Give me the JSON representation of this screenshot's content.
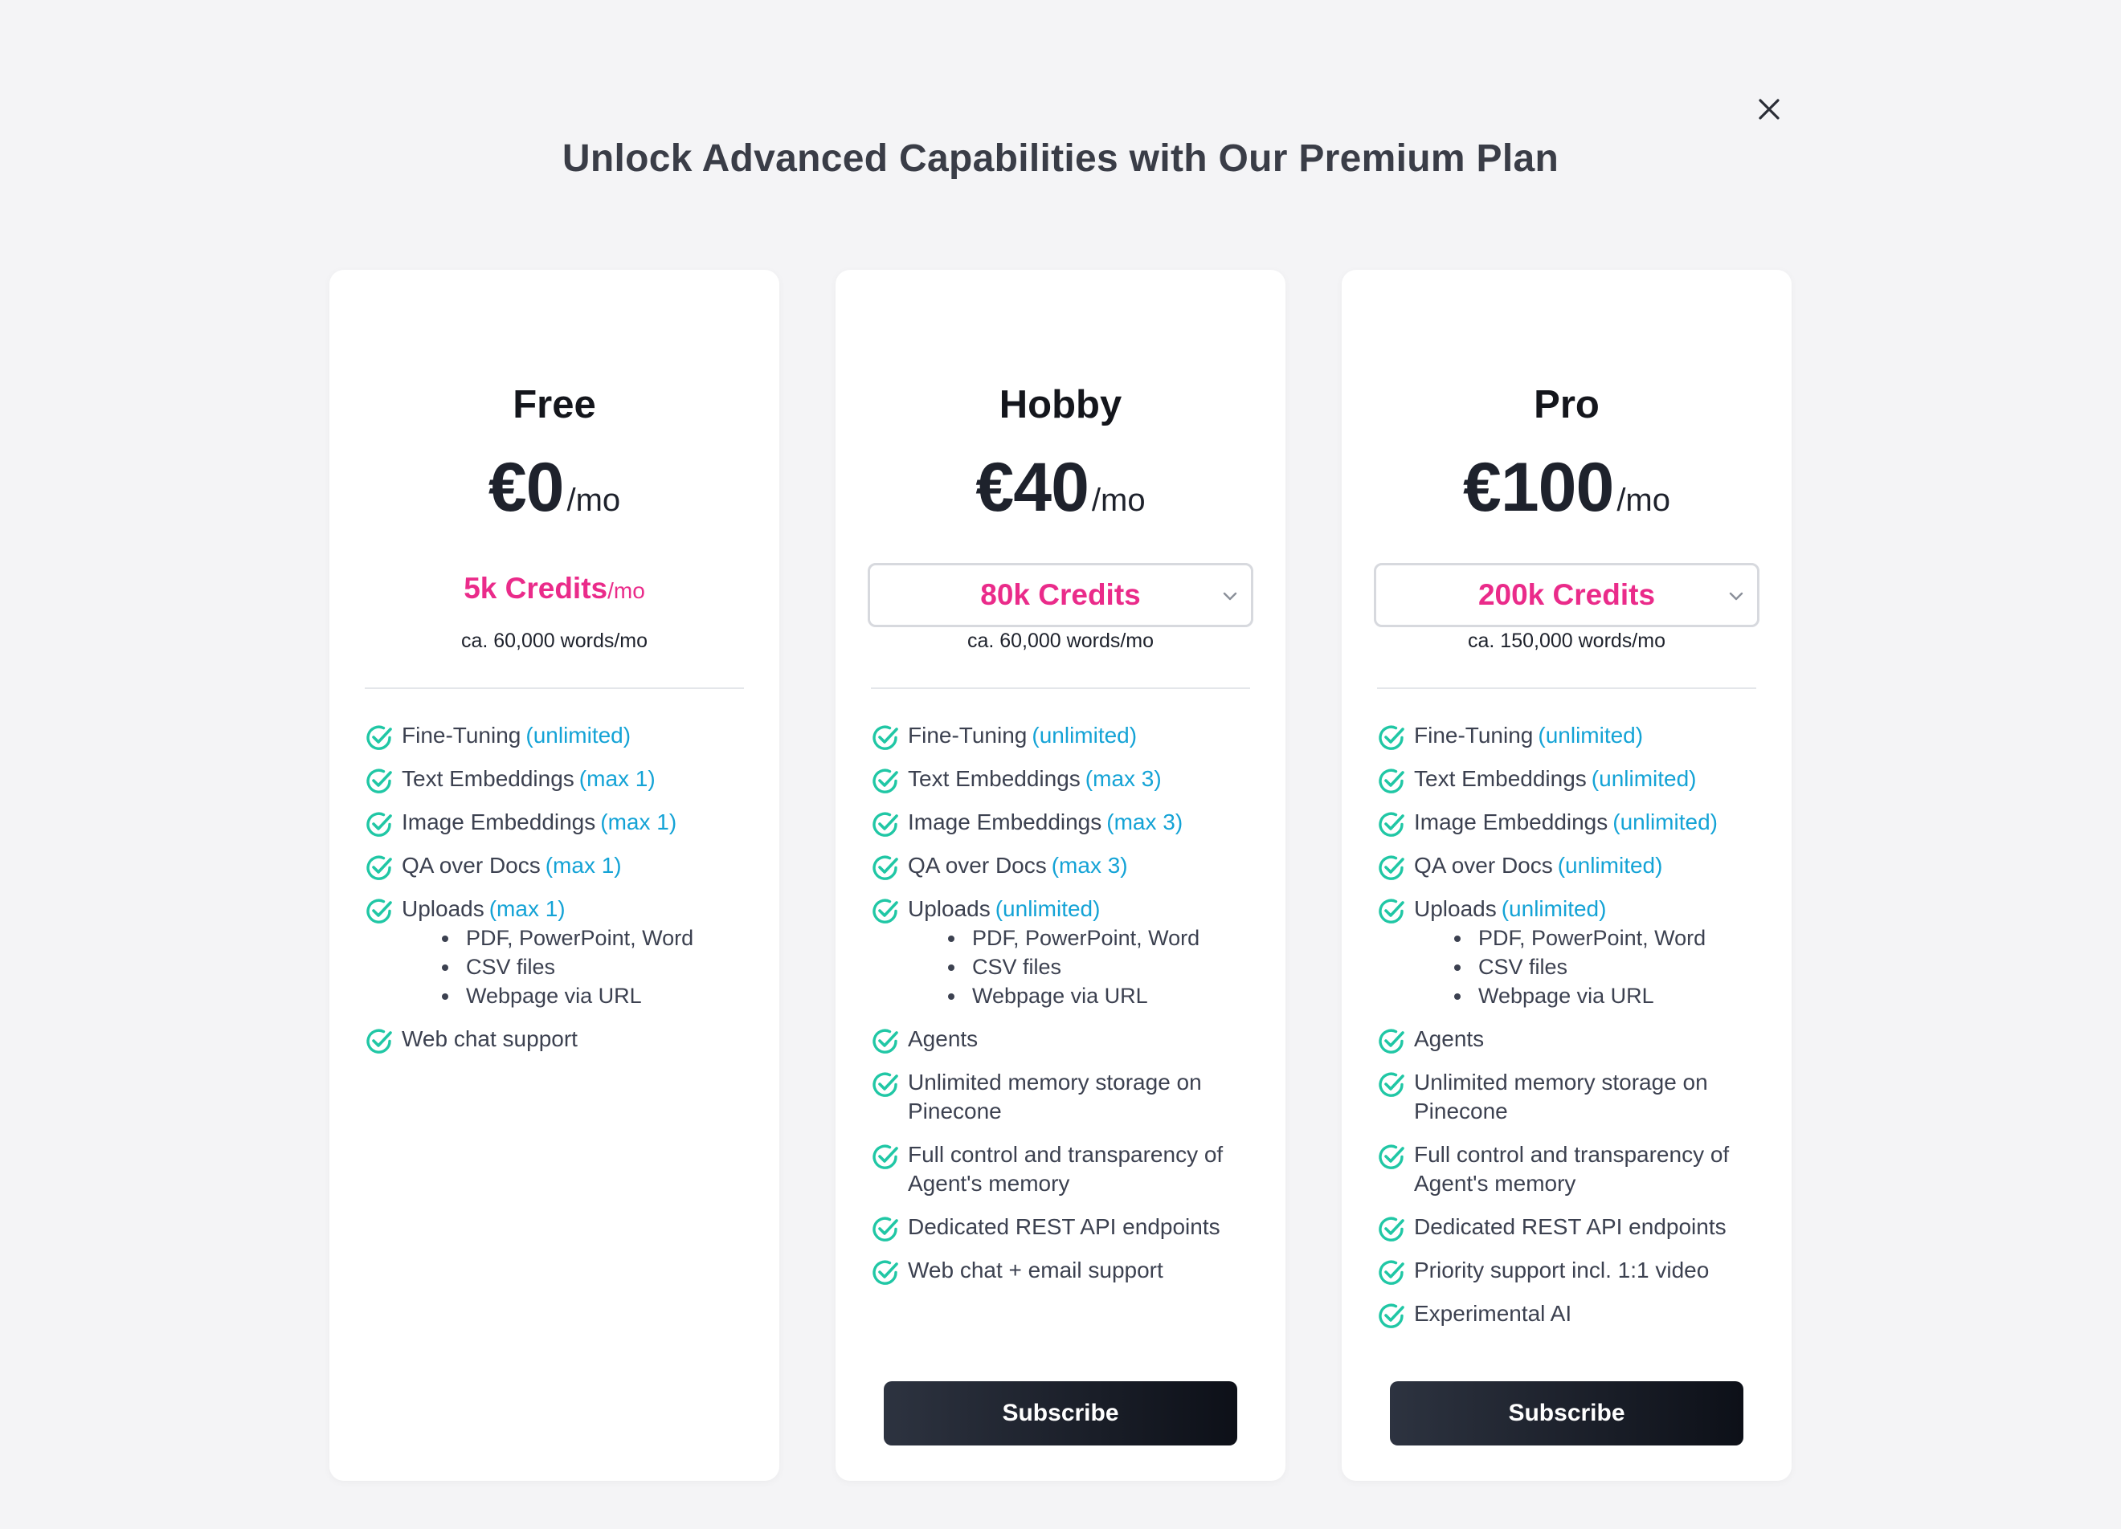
{
  "header": {
    "title": "Unlock Advanced Capabilities with Our Premium Plan",
    "close_icon": "close-icon"
  },
  "colors": {
    "accent_pink": "#ea2b8a",
    "note_blue": "#14a3d6",
    "check_green": "#20c7a5",
    "button_dark": "#111520"
  },
  "plans": [
    {
      "name": "Free",
      "price": "€0",
      "per": "/mo",
      "credits": "5k Credits",
      "credits_per": "/mo",
      "credits_dropdown": false,
      "words": "ca. 60,000 words/mo",
      "features": [
        {
          "text": "Fine-Tuning",
          "note": "(unlimited)"
        },
        {
          "text": "Text Embeddings",
          "note": "(max 1)"
        },
        {
          "text": "Image Embeddings",
          "note": "(max 1)"
        },
        {
          "text": "QA over Docs",
          "note": "(max 1)"
        },
        {
          "text": "Uploads",
          "note": "(max 1)",
          "sub": [
            "PDF, PowerPoint, Word",
            "CSV files",
            "Webpage via URL"
          ]
        },
        {
          "text": "Web chat support"
        }
      ],
      "subscribe_label": null
    },
    {
      "name": "Hobby",
      "price": "€40",
      "per": "/mo",
      "credits": "80k Credits",
      "credits_dropdown": true,
      "words": "ca. 60,000 words/mo",
      "features": [
        {
          "text": "Fine-Tuning",
          "note": "(unlimited)"
        },
        {
          "text": "Text Embeddings",
          "note": "(max 3)"
        },
        {
          "text": "Image Embeddings",
          "note": "(max 3)"
        },
        {
          "text": "QA over Docs",
          "note": "(max 3)"
        },
        {
          "text": "Uploads",
          "note": "(unlimited)",
          "sub": [
            "PDF, PowerPoint, Word",
            "CSV files",
            "Webpage via URL"
          ]
        },
        {
          "text": "Agents"
        },
        {
          "text": "Unlimited memory storage on Pinecone"
        },
        {
          "text": "Full control and transparency of Agent's memory"
        },
        {
          "text": "Dedicated REST API endpoints"
        },
        {
          "text": "Web chat + email support"
        }
      ],
      "subscribe_label": "Subscribe"
    },
    {
      "name": "Pro",
      "price": "€100",
      "per": "/mo",
      "credits": "200k Credits",
      "credits_dropdown": true,
      "words": "ca. 150,000 words/mo",
      "features": [
        {
          "text": "Fine-Tuning",
          "note": "(unlimited)"
        },
        {
          "text": "Text Embeddings",
          "note": "(unlimited)"
        },
        {
          "text": "Image Embeddings",
          "note": "(unlimited)"
        },
        {
          "text": "QA over Docs",
          "note": "(unlimited)"
        },
        {
          "text": "Uploads",
          "note": "(unlimited)",
          "sub": [
            "PDF, PowerPoint, Word",
            "CSV files",
            "Webpage via URL"
          ]
        },
        {
          "text": "Agents"
        },
        {
          "text": "Unlimited memory storage on Pinecone"
        },
        {
          "text": "Full control and transparency of Agent's memory"
        },
        {
          "text": "Dedicated REST API endpoints"
        },
        {
          "text": "Priority support incl. 1:1 video"
        },
        {
          "text": "Experimental AI"
        }
      ],
      "subscribe_label": "Subscribe"
    }
  ]
}
